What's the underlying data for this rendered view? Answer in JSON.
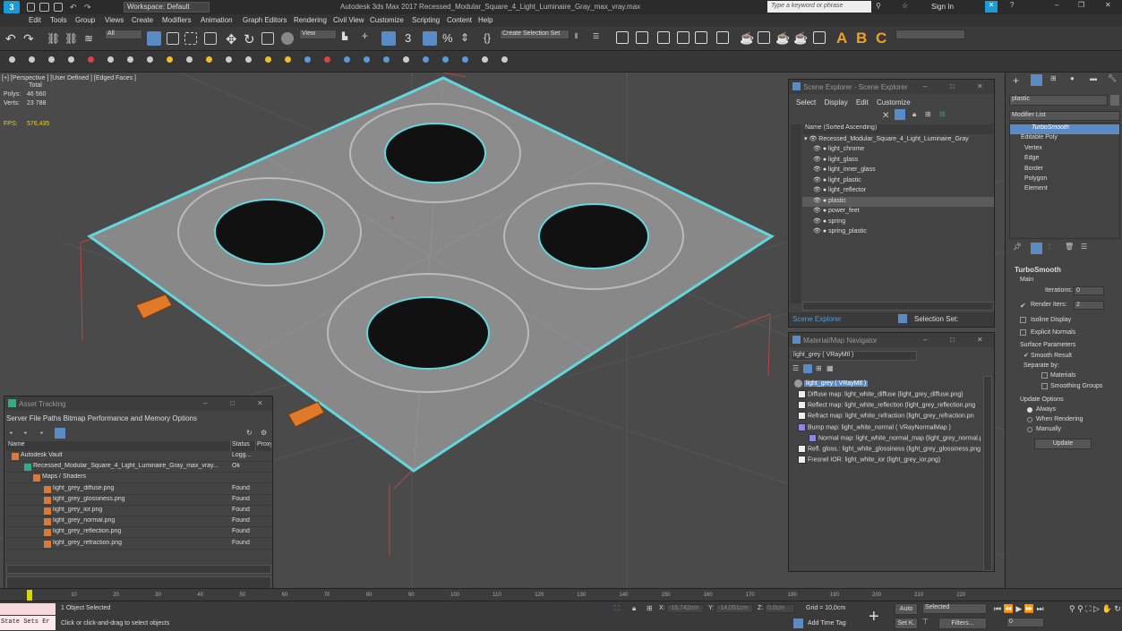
{
  "app_title": "Autodesk 3ds Max 2017    Recessed_Modular_Square_4_Light_Luminaire_Gray_max_vray.max",
  "workspace": "Workspace: Default",
  "search_placeholder": "Type a keyword or phrase",
  "sign_in": "Sign In",
  "menu": [
    "Edit",
    "Tools",
    "Group",
    "Views",
    "Create",
    "Modifiers",
    "Animation",
    "Graph Editors",
    "Rendering",
    "Civil View",
    "Customize",
    "Scripting",
    "Content",
    "Help"
  ],
  "toolbar": {
    "filter": "All",
    "view": "View",
    "selection_set": "Create Selection Set"
  },
  "viewport": {
    "label": "[+] [Perspective ] [User Defined ] [Edged Faces ]",
    "total": "Total",
    "polys_label": "Polys:",
    "polys": "46 560",
    "verts_label": "Verts:",
    "verts": "23 788",
    "fps_label": "FPS:",
    "fps": "576,435"
  },
  "scene_explorer": {
    "title": "Scene Explorer - Scene Explorer",
    "menu": [
      "Select",
      "Display",
      "Edit",
      "Customize"
    ],
    "column": "Name (Sorted Ascending)",
    "root": "Recessed_Modular_Square_4_Light_Luminaire_Gray",
    "items": [
      "light_chrome",
      "light_glass",
      "light_inner_glass",
      "light_plastic",
      "light_reflector",
      "plastic",
      "power_feet",
      "spring",
      "spring_plastic"
    ],
    "selected": "plastic",
    "footer_left": "Scene Explorer",
    "footer_right": "Selection Set:"
  },
  "material_nav": {
    "title": "Material/Map Navigator",
    "current": "light_grey  ( VRayMtl )",
    "root": "light_grey  ( VRayMtl )",
    "maps": [
      "Diffuse map: light_white_diffuse (light_grey_diffuse.png)",
      "Reflect map: light_white_reflection (light_grey_reflection.png",
      "Refract map: light_white_refraction (light_grey_refraction.pn",
      "Bump map: light_white_normal  ( VRayNormalMap )",
      "Normal map: light_white_normal_map (light_grey_normal.p",
      "Refl. gloss.: light_white_glossiness (light_grey_glossiness.png",
      "Fresnel IOR: light_white_ior (light_grey_ior.png)"
    ]
  },
  "asset_tracking": {
    "title": "Asset Tracking",
    "menu": "Server  File  Paths  Bitmap Performance and Memory  Options",
    "columns": [
      "Name",
      "Status",
      "Proxy"
    ],
    "rows": [
      {
        "name": "Autodesk Vault",
        "status": "Logg..."
      },
      {
        "name": "Recessed_Modular_Square_4_Light_Luminaire_Gray_max_vray...",
        "status": "Ok"
      },
      {
        "name": "Maps / Shaders",
        "status": ""
      },
      {
        "name": "light_grey_diffuse.png",
        "status": "Found"
      },
      {
        "name": "light_grey_glossiness.png",
        "status": "Found"
      },
      {
        "name": "light_grey_ior.png",
        "status": "Found"
      },
      {
        "name": "light_grey_normal.png",
        "status": "Found"
      },
      {
        "name": "light_grey_reflection.png",
        "status": "Found"
      },
      {
        "name": "light_grey_refraction.png",
        "status": "Found"
      }
    ]
  },
  "command_panel": {
    "search": "plastic",
    "modifier_list": "Modifier List",
    "stack": [
      "TurboSmooth",
      "Editable Poly",
      "Vertex",
      "Edge",
      "Border",
      "Polygon",
      "Element"
    ],
    "rollout": "TurboSmooth",
    "main": "Main",
    "iterations_label": "Iterations:",
    "iterations": "0",
    "render_iters_label": "Render Iters:",
    "render_iters": "2",
    "isoline": "Isoline Display",
    "explicit": "Explicit Normals",
    "surface": "Surface Parameters",
    "smooth": "Smooth Result",
    "separate": "Separate by:",
    "materials": "Materials",
    "smoothing": "Smoothing Groups",
    "update_options": "Update Options",
    "always": "Always",
    "when_rendering": "When Rendering",
    "manually": "Manually",
    "update": "Update"
  },
  "timeline": {
    "ticks": [
      "0",
      "10",
      "20",
      "30",
      "40",
      "50",
      "60",
      "70",
      "80",
      "90",
      "100",
      "110",
      "120",
      "130",
      "140",
      "150",
      "160",
      "170",
      "180",
      "190",
      "200",
      "210",
      "220"
    ],
    "frame": "0 / 225"
  },
  "status": {
    "maxscript": "State Sets Er",
    "selected": "1 Object Selected",
    "hint": "Click or click-and-drag to select objects",
    "x_label": "X:",
    "x": "-16,742cm",
    "y_label": "Y:",
    "y": "-14,051cm",
    "z_label": "Z:",
    "z": "0,0cm",
    "grid": "Grid = 10,0cm",
    "add_time_tag": "Add Time Tag",
    "auto": "Auto",
    "selected_dd": "Selected",
    "set_k": "Set K.",
    "filters": "Filters...",
    "frame_val": "0"
  }
}
